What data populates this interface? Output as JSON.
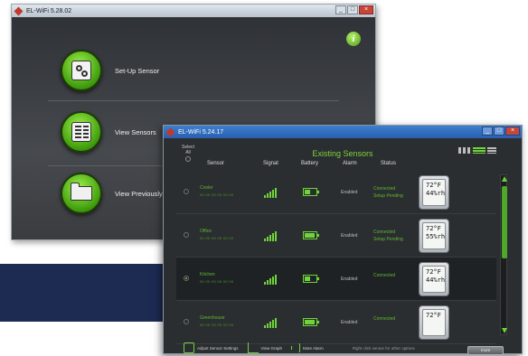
{
  "back_window": {
    "title": "EL-WiFi 5.28.02",
    "menu": [
      {
        "label": "Set-Up Sensor",
        "icon": "setup-icon"
      },
      {
        "label": "View Sensors",
        "icon": "sensors-icon"
      },
      {
        "label": "View Previously",
        "icon": "folder-icon"
      }
    ],
    "info_icon": "i"
  },
  "front_window": {
    "title": "EL-WiFi 5.24.17",
    "heading": "Existing Sensors",
    "select_all": "Select All",
    "columns": {
      "sensor": "Sensor",
      "signal": "Signal",
      "battery": "Battery",
      "alarm": "Alarm",
      "status": "Status"
    },
    "rows": [
      {
        "name": "Cooler",
        "mac": "00 00 00 00 00 00",
        "signal_bars": 5,
        "battery_level": 0.5,
        "alarm": "Enabled",
        "status1": "Connected",
        "status2": "Setup Pending",
        "temp": "72°F",
        "rh": "44%rh",
        "selected": false
      },
      {
        "name": "Office",
        "mac": "00 00 00 00 00 00",
        "signal_bars": 5,
        "battery_level": 0.9,
        "alarm": "Enabled",
        "status1": "Connected",
        "status2": "Setup Pending",
        "temp": "72°F",
        "rh": "55%rh",
        "selected": false
      },
      {
        "name": "Kitchen",
        "mac": "00 00 00 00 00 00",
        "signal_bars": 5,
        "battery_level": 0.5,
        "alarm": "Enabled",
        "status1": "Connected",
        "status2": "",
        "temp": "72°F",
        "rh": "44%rh",
        "selected": true
      },
      {
        "name": "Greenhouse",
        "mac": "00 00 00 00 00 00",
        "signal_bars": 5,
        "battery_level": 0.9,
        "alarm": "Enabled",
        "status1": "Connected",
        "status2": "",
        "temp": "72°F",
        "rh": "",
        "selected": false
      }
    ],
    "footer": {
      "adjust": "Adjust Sensor Settings",
      "graph": "View Graph",
      "mute": "Mute Alarm",
      "hint": "Right click sensor for other options",
      "more": "more"
    }
  },
  "colors": {
    "accent": "#6fd43a",
    "navy": "#1d2a52",
    "window_bg": "#2b2e30"
  }
}
